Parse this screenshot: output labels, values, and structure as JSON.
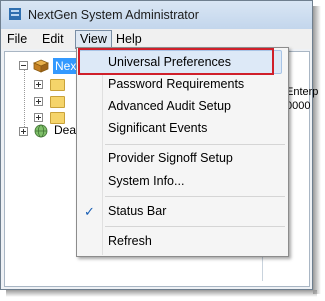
{
  "window": {
    "title": "NextGen System Administrator"
  },
  "menubar": {
    "items": [
      "File",
      "Edit",
      "View",
      "Help"
    ]
  },
  "tree": {
    "root_label": "Nex",
    "dea_label": "Dea"
  },
  "background_text": {
    "fragment1": "Enterp",
    "fragment2": "0000"
  },
  "view_menu": {
    "items": [
      "Universal Preferences",
      "Password Requirements",
      "Advanced Audit Setup",
      "Significant Events",
      "Provider Signoff Setup",
      "System Info...",
      "Status Bar",
      "Refresh"
    ],
    "checked_item": "Status Bar",
    "check_glyph": "✓"
  },
  "colors": {
    "highlight_red": "#d01f2a",
    "selection_blue": "#3399ff"
  }
}
